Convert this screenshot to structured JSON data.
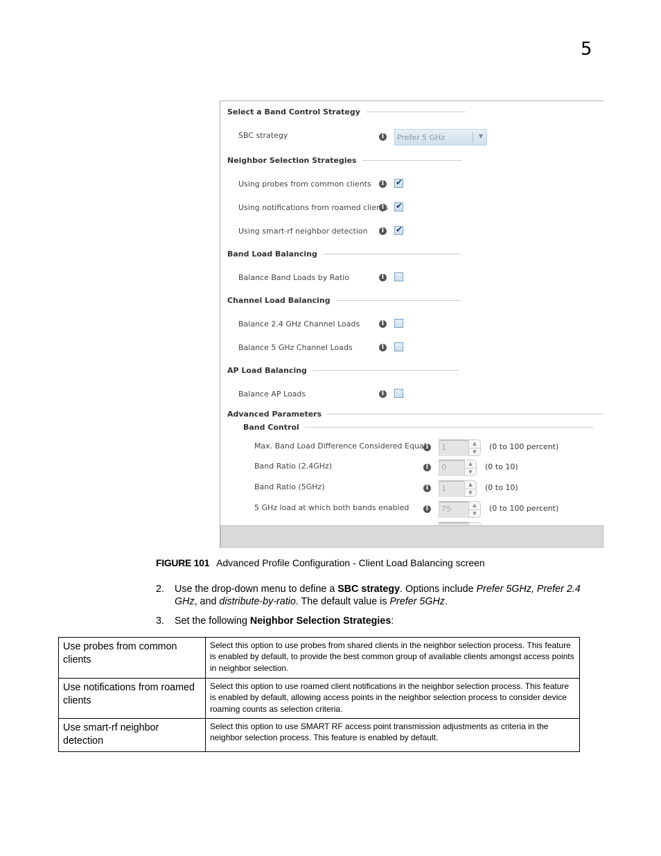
{
  "chapter_number": "5",
  "screenshot": {
    "sections": {
      "band_control_strategy": "Select a Band Control Strategy",
      "neighbor_selection": "Neighbor Selection Strategies",
      "band_load_balancing": "Band Load Balancing",
      "channel_load_balancing": "Channel Load Balancing",
      "ap_load_balancing": "AP Load Balancing",
      "advanced_parameters": "Advanced Parameters",
      "band_control": "Band Control"
    },
    "sbc_strategy": {
      "label": "SBC strategy",
      "value": "Prefer 5 GHz"
    },
    "checkboxes": [
      {
        "label": "Using probes from common clients",
        "checked": true
      },
      {
        "label": "Using notifications from roamed clients",
        "checked": true
      },
      {
        "label": "Using smart-rf neighbor detection",
        "checked": true
      },
      {
        "label": "Balance Band Loads by Ratio",
        "checked": false
      },
      {
        "label": "Balance 2.4 GHz Channel Loads",
        "checked": false
      },
      {
        "label": "Balance 5 GHz Channel Loads",
        "checked": false
      },
      {
        "label": "Balance AP Loads",
        "checked": false
      }
    ],
    "spinners": [
      {
        "label": "Max. Band Load Difference Considered Equal",
        "value": "1",
        "range": "(0 to 100 percent)"
      },
      {
        "label": "Band Ratio (2.4GHz)",
        "value": "0",
        "range": "(0 to 10)"
      },
      {
        "label": "Band Ratio (5GHz)",
        "value": "1",
        "range": "(0 to 10)"
      },
      {
        "label": "5 GHz load at which both bands enabled",
        "value": "75",
        "range": "(0 to 100 percent)"
      }
    ]
  },
  "caption": {
    "figure": "FIGURE 101",
    "text": "Advanced Profile Configuration - Client Load Balancing screen"
  },
  "steps": [
    {
      "number": "2.",
      "parts": {
        "a": "Use the drop-down menu to define a ",
        "b": "SBC strategy",
        "c": ". Options include ",
        "d": "Prefer 5GHz, Prefer 2.4 GHz",
        "e": ", and ",
        "f": "distribute-by-ratio",
        "g": ". The default value is ",
        "h": "Prefer 5GHz",
        "i": "."
      }
    },
    {
      "number": "3.",
      "parts": {
        "a": "Set the following ",
        "b": "Neighbor Selection Strategies",
        "c": ":"
      }
    }
  ],
  "table": [
    {
      "term": "Use probes from common clients",
      "definition": "Select this option to use probes from shared clients in the neighbor selection process. This feature is enabled by default, to provide the best common group of available clients amongst access points in neighbor selection."
    },
    {
      "term": "Use notifications from roamed clients",
      "definition": "Select this option to use roamed client notifications in the neighbor selection process. This feature is enabled by default, allowing access points in the neighbor selection process to consider device roaming counts as selection criteria."
    },
    {
      "term": "Use smart-rf neighbor detection",
      "definition": "Select this option to use SMART RF access point transmission adjustments as criteria in the neighbor selection process. This feature is enabled by default."
    }
  ]
}
